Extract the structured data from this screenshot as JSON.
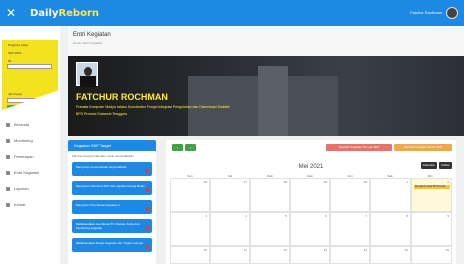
{
  "topbar": {
    "close": "✕",
    "brand_prefix": "Daily",
    "brand_suffix": "Reborn",
    "user": "Fatchur Rochman"
  },
  "sidebar": {
    "status_labels": [
      "Progress Kerja",
      "SKP 2021",
      "RL",
      "Jam Kerja"
    ],
    "nav": [
      "Beranda",
      "Monitoring",
      "Penerapan",
      "Entri Kegiatan",
      "Laporan",
      "Keluar"
    ]
  },
  "header": {
    "title": "Entri Kegiatan",
    "subtitle": "Home / Entri Kegiatan"
  },
  "banner": {
    "name": "FATCHUR ROCHMAN",
    "desc1": "Pranata Komputer Madya selaku Koordinator Fungsi Integrasi Pengolahan dan Diseminasi Statistik",
    "desc2": "BPS Provinsi Sulawesi Tenggara"
  },
  "tasks": {
    "header": "Kegiatan SKP Target",
    "subtitle": "Klik dan drag ke kalender untuk memindahkan",
    "items": [
      "Menyusun perencanaan kerja statistik",
      "Menyusun Rencana SKP dan capaian kinerja Bulan",
      "Menyusun Koordinasi Kegiatan 1",
      "Melaksanakan koordinasi Tim Satuan Kerja dan Monitoring kegiatan",
      "Melaksanakan Rapat Kegiatan dan Tugas Lainnya"
    ]
  },
  "calendar": {
    "prev": "‹",
    "next": "›",
    "btn_red": "Tambah Kegiatan Di Luar SKP",
    "btn_orange": "Tambah Kegiatan Rutin SKP",
    "month": "Mei 2021",
    "view_month": "Kalender",
    "view_list": "Daftar",
    "days": [
      "Sen",
      "Sel",
      "Rab",
      "Kam",
      "Jum",
      "Sab",
      "Min"
    ],
    "event": "Mengikuti rapat BPS/virtual",
    "dates": [
      "26",
      "27",
      "28",
      "29",
      "30",
      "1",
      "2",
      "3",
      "4",
      "5",
      "6",
      "7",
      "8",
      "9",
      "10",
      "11",
      "12",
      "13",
      "14",
      "15",
      "16"
    ]
  }
}
